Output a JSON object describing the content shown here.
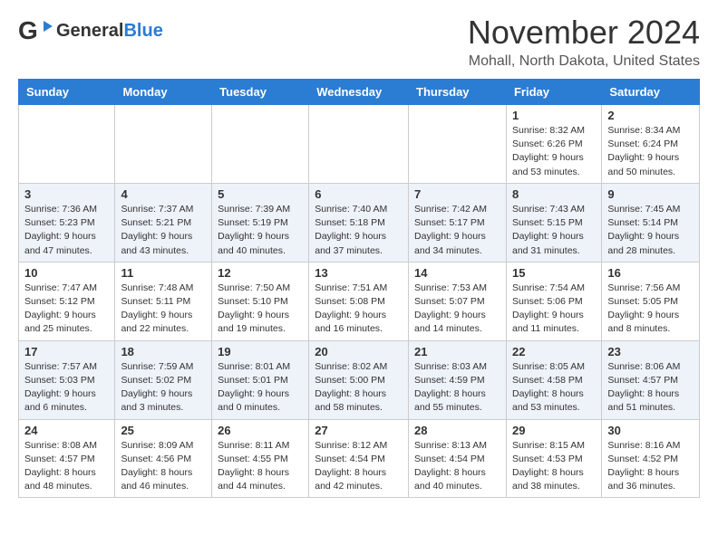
{
  "header": {
    "logo_general": "General",
    "logo_blue": "Blue",
    "month_title": "November 2024",
    "location": "Mohall, North Dakota, United States"
  },
  "days_of_week": [
    "Sunday",
    "Monday",
    "Tuesday",
    "Wednesday",
    "Thursday",
    "Friday",
    "Saturday"
  ],
  "weeks": [
    [
      {
        "day": "",
        "info": ""
      },
      {
        "day": "",
        "info": ""
      },
      {
        "day": "",
        "info": ""
      },
      {
        "day": "",
        "info": ""
      },
      {
        "day": "",
        "info": ""
      },
      {
        "day": "1",
        "info": "Sunrise: 8:32 AM\nSunset: 6:26 PM\nDaylight: 9 hours\nand 53 minutes."
      },
      {
        "day": "2",
        "info": "Sunrise: 8:34 AM\nSunset: 6:24 PM\nDaylight: 9 hours\nand 50 minutes."
      }
    ],
    [
      {
        "day": "3",
        "info": "Sunrise: 7:36 AM\nSunset: 5:23 PM\nDaylight: 9 hours\nand 47 minutes."
      },
      {
        "day": "4",
        "info": "Sunrise: 7:37 AM\nSunset: 5:21 PM\nDaylight: 9 hours\nand 43 minutes."
      },
      {
        "day": "5",
        "info": "Sunrise: 7:39 AM\nSunset: 5:19 PM\nDaylight: 9 hours\nand 40 minutes."
      },
      {
        "day": "6",
        "info": "Sunrise: 7:40 AM\nSunset: 5:18 PM\nDaylight: 9 hours\nand 37 minutes."
      },
      {
        "day": "7",
        "info": "Sunrise: 7:42 AM\nSunset: 5:17 PM\nDaylight: 9 hours\nand 34 minutes."
      },
      {
        "day": "8",
        "info": "Sunrise: 7:43 AM\nSunset: 5:15 PM\nDaylight: 9 hours\nand 31 minutes."
      },
      {
        "day": "9",
        "info": "Sunrise: 7:45 AM\nSunset: 5:14 PM\nDaylight: 9 hours\nand 28 minutes."
      }
    ],
    [
      {
        "day": "10",
        "info": "Sunrise: 7:47 AM\nSunset: 5:12 PM\nDaylight: 9 hours\nand 25 minutes."
      },
      {
        "day": "11",
        "info": "Sunrise: 7:48 AM\nSunset: 5:11 PM\nDaylight: 9 hours\nand 22 minutes."
      },
      {
        "day": "12",
        "info": "Sunrise: 7:50 AM\nSunset: 5:10 PM\nDaylight: 9 hours\nand 19 minutes."
      },
      {
        "day": "13",
        "info": "Sunrise: 7:51 AM\nSunset: 5:08 PM\nDaylight: 9 hours\nand 16 minutes."
      },
      {
        "day": "14",
        "info": "Sunrise: 7:53 AM\nSunset: 5:07 PM\nDaylight: 9 hours\nand 14 minutes."
      },
      {
        "day": "15",
        "info": "Sunrise: 7:54 AM\nSunset: 5:06 PM\nDaylight: 9 hours\nand 11 minutes."
      },
      {
        "day": "16",
        "info": "Sunrise: 7:56 AM\nSunset: 5:05 PM\nDaylight: 9 hours\nand 8 minutes."
      }
    ],
    [
      {
        "day": "17",
        "info": "Sunrise: 7:57 AM\nSunset: 5:03 PM\nDaylight: 9 hours\nand 6 minutes."
      },
      {
        "day": "18",
        "info": "Sunrise: 7:59 AM\nSunset: 5:02 PM\nDaylight: 9 hours\nand 3 minutes."
      },
      {
        "day": "19",
        "info": "Sunrise: 8:01 AM\nSunset: 5:01 PM\nDaylight: 9 hours\nand 0 minutes."
      },
      {
        "day": "20",
        "info": "Sunrise: 8:02 AM\nSunset: 5:00 PM\nDaylight: 8 hours\nand 58 minutes."
      },
      {
        "day": "21",
        "info": "Sunrise: 8:03 AM\nSunset: 4:59 PM\nDaylight: 8 hours\nand 55 minutes."
      },
      {
        "day": "22",
        "info": "Sunrise: 8:05 AM\nSunset: 4:58 PM\nDaylight: 8 hours\nand 53 minutes."
      },
      {
        "day": "23",
        "info": "Sunrise: 8:06 AM\nSunset: 4:57 PM\nDaylight: 8 hours\nand 51 minutes."
      }
    ],
    [
      {
        "day": "24",
        "info": "Sunrise: 8:08 AM\nSunset: 4:57 PM\nDaylight: 8 hours\nand 48 minutes."
      },
      {
        "day": "25",
        "info": "Sunrise: 8:09 AM\nSunset: 4:56 PM\nDaylight: 8 hours\nand 46 minutes."
      },
      {
        "day": "26",
        "info": "Sunrise: 8:11 AM\nSunset: 4:55 PM\nDaylight: 8 hours\nand 44 minutes."
      },
      {
        "day": "27",
        "info": "Sunrise: 8:12 AM\nSunset: 4:54 PM\nDaylight: 8 hours\nand 42 minutes."
      },
      {
        "day": "28",
        "info": "Sunrise: 8:13 AM\nSunset: 4:54 PM\nDaylight: 8 hours\nand 40 minutes."
      },
      {
        "day": "29",
        "info": "Sunrise: 8:15 AM\nSunset: 4:53 PM\nDaylight: 8 hours\nand 38 minutes."
      },
      {
        "day": "30",
        "info": "Sunrise: 8:16 AM\nSunset: 4:52 PM\nDaylight: 8 hours\nand 36 minutes."
      }
    ]
  ]
}
